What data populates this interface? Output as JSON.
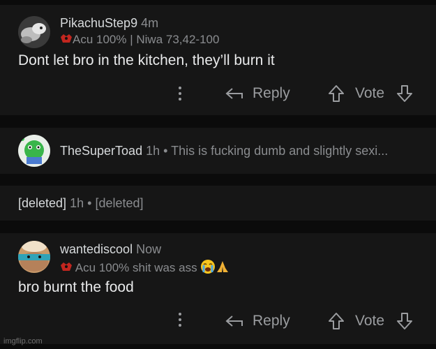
{
  "comments": [
    {
      "username": "PikachuStep9",
      "time": "4m",
      "flair": "Acu 100% | Niwa 73,42-100",
      "body": "Dont let bro in the kitchen, they’ll burn it"
    },
    {
      "username": "TheSuperToad",
      "time": "1h",
      "separator": "•",
      "preview": "This is fucking dumb and slightly sexi..."
    },
    {
      "username": "[deleted]",
      "time": "1h",
      "separator": "•",
      "preview": "[deleted]"
    },
    {
      "username": "wantediscool",
      "time": "Now",
      "flair": "Acu 100% shit was ass",
      "body": "bro burnt the food"
    }
  ],
  "actions": {
    "reply": "Reply",
    "vote": "Vote"
  },
  "watermark": "imgflip.com",
  "icons": [
    "more-vertical-icon",
    "reply-arrow-icon",
    "upvote-arrow-icon",
    "downvote-arrow-icon",
    "flair-emblem-icon",
    "crying-face-icon",
    "praying-hands-icon"
  ]
}
